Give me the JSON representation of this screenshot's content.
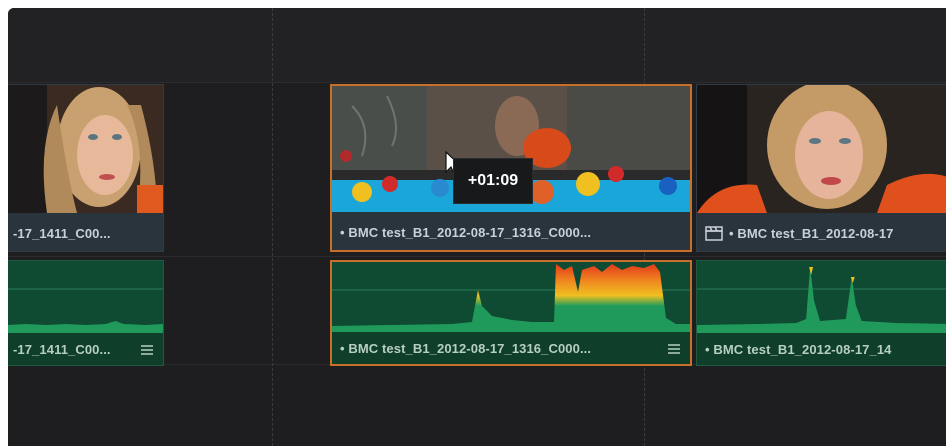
{
  "timeline": {
    "video_clips": [
      {
        "label": "-17_1411_C00..."
      },
      {
        "label": "BMC test_B1_2012-08-17_1316_C000..."
      },
      {
        "label": "BMC test_B1_2012-08-17"
      }
    ],
    "audio_clips": [
      {
        "label": "-17_1411_C00..."
      },
      {
        "label": "BMC test_B1_2012-08-17_1316_C000..."
      },
      {
        "label": "BMC test_B1_2012-08-17_14"
      }
    ],
    "drag_offset": "+01:09",
    "bullet": "•"
  },
  "colors": {
    "selection_border": "#c8702a",
    "audio_clip": "#114c34",
    "waveform": "#1f9a5a",
    "peak_high": "#e23a1a",
    "peak_mid": "#f0c020"
  },
  "icons": [
    "cursor-arrow-icon",
    "clapperboard-icon",
    "menu-lines-icon"
  ]
}
